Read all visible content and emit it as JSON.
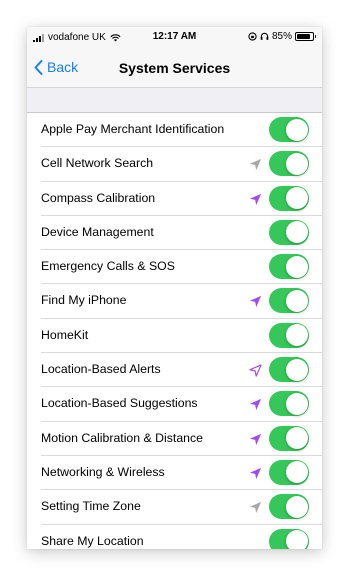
{
  "status_bar": {
    "carrier": "vodafone UK",
    "time": "12:17 AM",
    "battery": "85%",
    "battery_level": 0.85
  },
  "nav": {
    "back_label": "Back",
    "title": "System Services"
  },
  "colors": {
    "toggle_on": "#35c759",
    "accent": "#147efb",
    "loc_purple_filled": "#a14bf2",
    "loc_gray_filled": "#a6a6ab",
    "loc_purple_outline": "#a14bf2"
  },
  "services": [
    {
      "label": "Apple Pay Merchant Identification",
      "enabled": true,
      "location_icon": null
    },
    {
      "label": "Cell Network Search",
      "enabled": true,
      "location_icon": "gray-filled"
    },
    {
      "label": "Compass Calibration",
      "enabled": true,
      "location_icon": "purple-filled"
    },
    {
      "label": "Device Management",
      "enabled": true,
      "location_icon": null
    },
    {
      "label": "Emergency Calls & SOS",
      "enabled": true,
      "location_icon": null
    },
    {
      "label": "Find My iPhone",
      "enabled": true,
      "location_icon": "purple-filled"
    },
    {
      "label": "HomeKit",
      "enabled": true,
      "location_icon": null
    },
    {
      "label": "Location-Based Alerts",
      "enabled": true,
      "location_icon": "purple-outline"
    },
    {
      "label": "Location-Based Suggestions",
      "enabled": true,
      "location_icon": "purple-filled"
    },
    {
      "label": "Motion Calibration & Distance",
      "enabled": true,
      "location_icon": "purple-filled"
    },
    {
      "label": "Networking & Wireless",
      "enabled": true,
      "location_icon": "purple-filled"
    },
    {
      "label": "Setting Time Zone",
      "enabled": true,
      "location_icon": "gray-filled"
    },
    {
      "label": "Share My Location",
      "enabled": true,
      "location_icon": null
    }
  ]
}
